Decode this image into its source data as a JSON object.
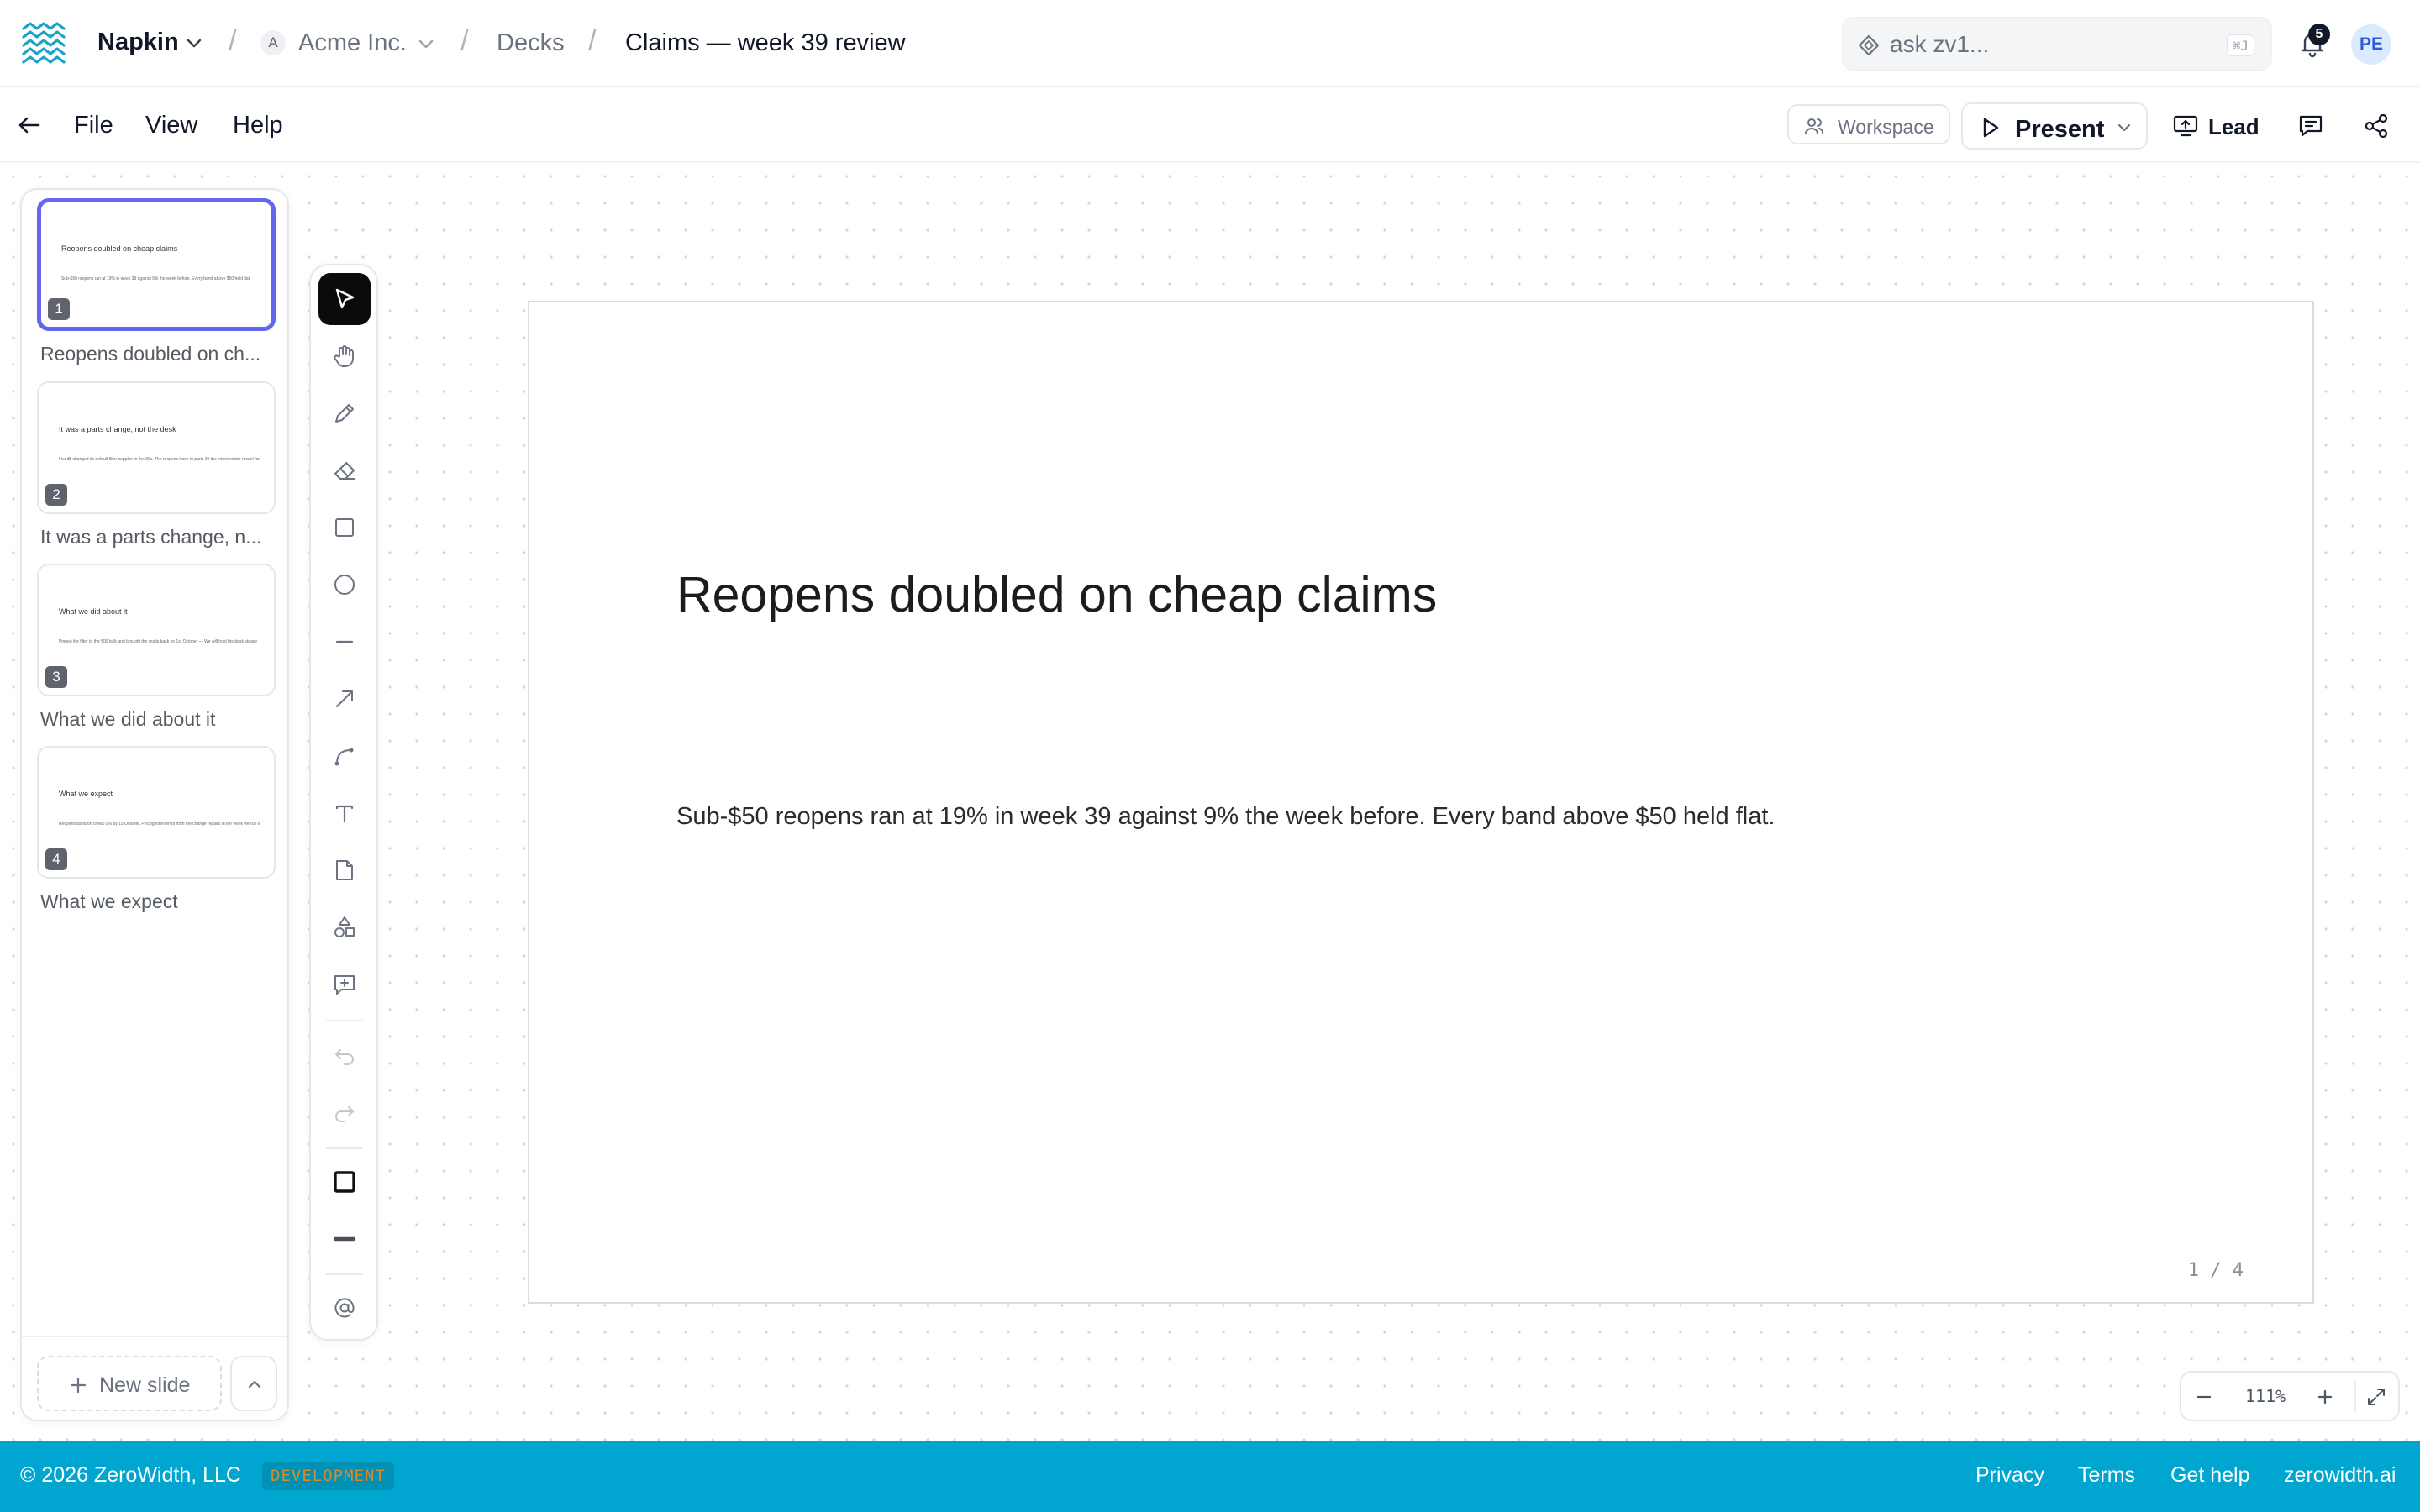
{
  "header": {
    "brand": "Napkin",
    "workspace_initial": "A",
    "workspace": "Acme Inc.",
    "separator": "/",
    "section": "Decks",
    "doc_title": "Claims — week 39 review",
    "search_placeholder": "ask zv1...",
    "search_shortcut": "⌘J",
    "notification_count": "5",
    "user_initials": "PE"
  },
  "menubar": {
    "items": [
      "File",
      "View",
      "Help"
    ],
    "workspace_label": "Workspace",
    "present_label": "Present",
    "lead_label": "Lead"
  },
  "slides": [
    {
      "number": "1",
      "title": "Reopens doubled on cheap claims",
      "label": "Reopens doubled on ch...",
      "body": "Sub-$50 reopens ran at 19% in week 39 against 9% the week before. Every band above $50 held flat."
    },
    {
      "number": "2",
      "title": "It was a parts change, not the desk",
      "label": "It was a parts change, n...",
      "body": "Fixed$ changed its default filter supplier in the 30s. The reopens trace to parts 30 the intermediate model families"
    },
    {
      "number": "3",
      "title": "What we did about it",
      "label": "What we did about it",
      "body": "Pinned the filter to the 500 bulk and brought the drafts back on 1st October — We will hold the desk steady"
    },
    {
      "number": "4",
      "title": "What we expect",
      "label": "What we expect",
      "body": "Reopens band on cheap 9% by 15 October. Pricing intervenes from the change repairs in the week we run to finish the data"
    }
  ],
  "panel": {
    "new_slide_label": "New slide"
  },
  "current_slide": {
    "title": "Reopens doubled on cheap claims",
    "body": "Sub-$50 reopens ran at 19% in week 39 against 9% the week before. Every band above $50 held flat.",
    "counter": "1 / 4"
  },
  "tools": [
    {
      "name": "select-tool",
      "icon": "cursor-arrow-icon",
      "active": true
    },
    {
      "name": "hand-tool",
      "icon": "hand-icon"
    },
    {
      "name": "pencil-tool",
      "icon": "pencil-icon"
    },
    {
      "name": "eraser-tool",
      "icon": "eraser-icon"
    },
    {
      "name": "rectangle-tool",
      "icon": "square-icon"
    },
    {
      "name": "ellipse-tool",
      "icon": "circle-icon"
    },
    {
      "name": "line-tool",
      "icon": "line-icon"
    },
    {
      "name": "arrow-tool",
      "icon": "arrow-diagonal-icon"
    },
    {
      "name": "curve-tool",
      "icon": "bezier-curve-icon"
    },
    {
      "name": "text-tool",
      "icon": "text-icon"
    },
    {
      "name": "sticky-note-tool",
      "icon": "note-icon"
    },
    {
      "name": "shapes-tool",
      "icon": "shapes-icon"
    },
    {
      "name": "comment-tool",
      "icon": "comment-add-icon"
    },
    {
      "name": "undo-button",
      "icon": "undo-icon"
    },
    {
      "name": "redo-button",
      "icon": "redo-icon"
    },
    {
      "name": "stroke-color-swatch",
      "icon": "square-outline-icon"
    },
    {
      "name": "stroke-width-picker",
      "icon": "line-thick-icon"
    },
    {
      "name": "mention-button",
      "icon": "at-sign-icon"
    }
  ],
  "zoom": {
    "value": "111%"
  },
  "footer": {
    "copyright": "© 2026 ZeroWidth, LLC",
    "env_badge": "DEVELOPMENT",
    "links": [
      "Privacy",
      "Terms",
      "Get help",
      "zerowidth.ai"
    ]
  },
  "colors": {
    "accent": "#6366f1",
    "footer_bg": "#00a6cf",
    "env_badge_text": "#d98a2b",
    "avatar_bg": "#dbeafe"
  }
}
